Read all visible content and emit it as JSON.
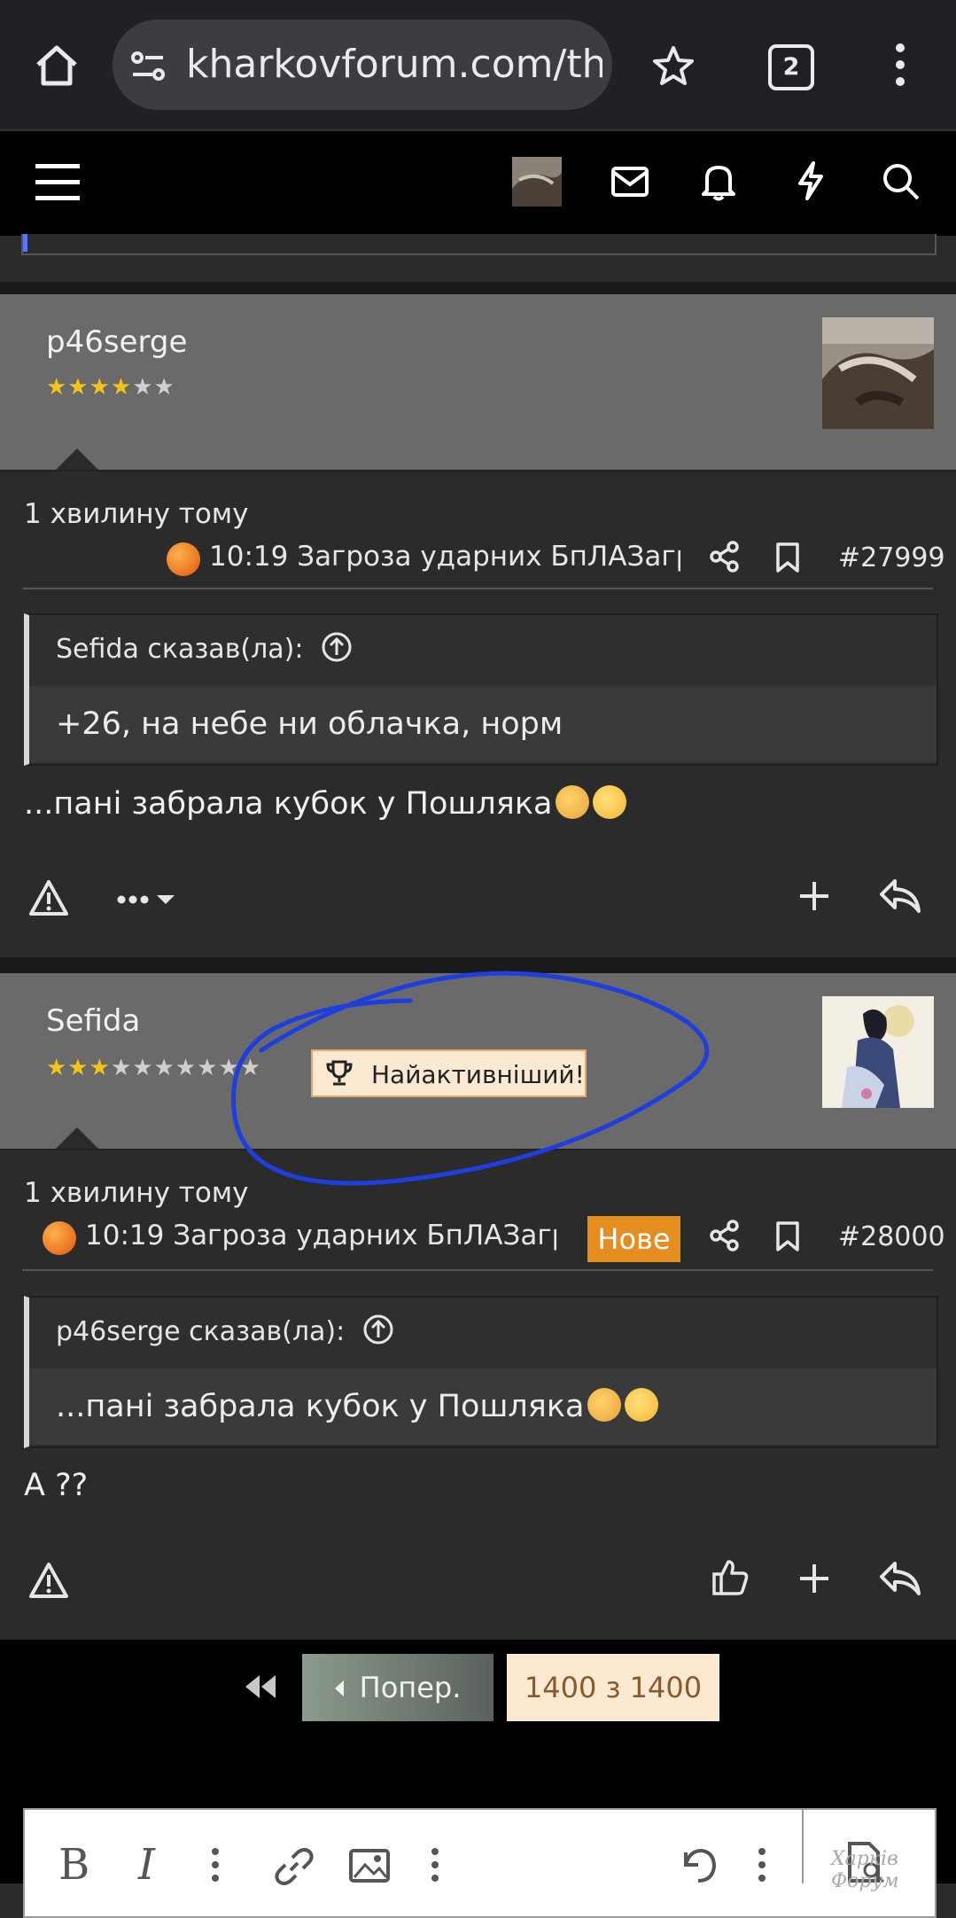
{
  "browser": {
    "url": "kharkovforum.com/th",
    "tab_count": "2"
  },
  "posts": [
    {
      "username": "p46serge",
      "stars_on": "★★★★",
      "stars_off": "★★",
      "time": "1 хвилину тому",
      "title": "10:19 Загроза ударних БпЛАЗагр",
      "post_number": "#27999",
      "quote_author": "Sefida сказав(ла):",
      "quote_text": "+26, на небе ни облачка, норм",
      "body": "...пані забрала кубок у Пошляка"
    },
    {
      "username": "Sefida",
      "stars_on": "★★★",
      "stars_off": "★★★★★★★",
      "badge": "Найактивніший!",
      "time": "1 хвилину тому",
      "title": "10:19 Загроза ударних БпЛАЗагр",
      "new_label": "Нове",
      "post_number": "#28000",
      "quote_author": "p46serge сказав(ла):",
      "quote_text": "...пані забрала кубок у Пошляка",
      "body": "А ??"
    }
  ],
  "pagination": {
    "prev_label": "Попер.",
    "page_label": "1400 з 1400"
  },
  "watermark": "Харків Форум",
  "colors": {
    "accent_orange": "#e58d1e",
    "star_gold": "#f3c319",
    "annotation_blue": "#1f3ee0"
  }
}
